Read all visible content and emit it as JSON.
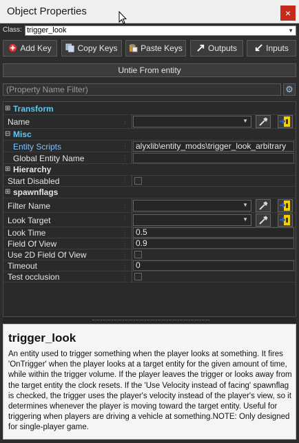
{
  "window": {
    "title": "Object Properties",
    "close_label": "×"
  },
  "class_row": {
    "label": "Class:",
    "value": "trigger_look"
  },
  "toolbar": {
    "add_key": "Add Key",
    "copy_keys": "Copy Keys",
    "paste_keys": "Paste Keys",
    "outputs": "Outputs",
    "inputs": "Inputs"
  },
  "untie_button": "Untie From entity",
  "filter": {
    "placeholder": "(Property Name Filter)"
  },
  "grid": {
    "transform": {
      "label": "Transform",
      "toggle": "⊞"
    },
    "name": {
      "label": "Name",
      "value": ""
    },
    "misc": {
      "label": "Misc",
      "toggle": "⊟"
    },
    "entity_scripts": {
      "label": "Entity Scripts",
      "value": "alyxlib\\entity_mods\\trigger_look_arbitrary"
    },
    "global_entity_name": {
      "label": "Global Entity Name",
      "value": ""
    },
    "hierarchy": {
      "label": "Hierarchy",
      "toggle": "⊞"
    },
    "start_disabled": {
      "label": "Start Disabled"
    },
    "spawnflags": {
      "label": "spawnflags",
      "toggle": "⊞"
    },
    "filter_name": {
      "label": "Filter Name",
      "value": ""
    },
    "look_target": {
      "label": "Look Target",
      "value": ""
    },
    "look_time": {
      "label": "Look Time",
      "value": "0.5"
    },
    "field_of_view": {
      "label": "Field Of View",
      "value": "0.9"
    },
    "use_2d_fov": {
      "label": "Use 2D Field Of View"
    },
    "timeout": {
      "label": "Timeout",
      "value": "0"
    },
    "test_occlusion": {
      "label": "Test occlusion"
    }
  },
  "description": {
    "title": "trigger_look",
    "text": "An entity used to trigger something when the player looks at something. It fires 'OnTrigger' when the player looks at a target entity for the given amount of time, while within the trigger volume. If the player leaves the trigger or looks away from the target entity the clock resets. If the 'Use Velocity instead of facing' spawnflag is checked, the trigger uses the player's velocity instead of the player's view, so it determines whenever the player is moving toward the target entity. Useful for triggering when players are driving a vehicle at something.NOTE: Only designed for single-player game."
  },
  "icons": {
    "add": "add-icon",
    "copy": "copy-icon",
    "paste": "paste-icon",
    "outputs": "outputs-arrow-icon",
    "inputs": "inputs-arrow-icon",
    "gear": "gear-icon",
    "eyedropper": "eyedropper-icon",
    "pick": "pick-entity-icon"
  },
  "colors": {
    "accent": "#5ec8f0",
    "link": "#7fc3ff",
    "close": "#c42b1c",
    "add_icon": "#e03030",
    "pick_icon": "#f5d000"
  }
}
